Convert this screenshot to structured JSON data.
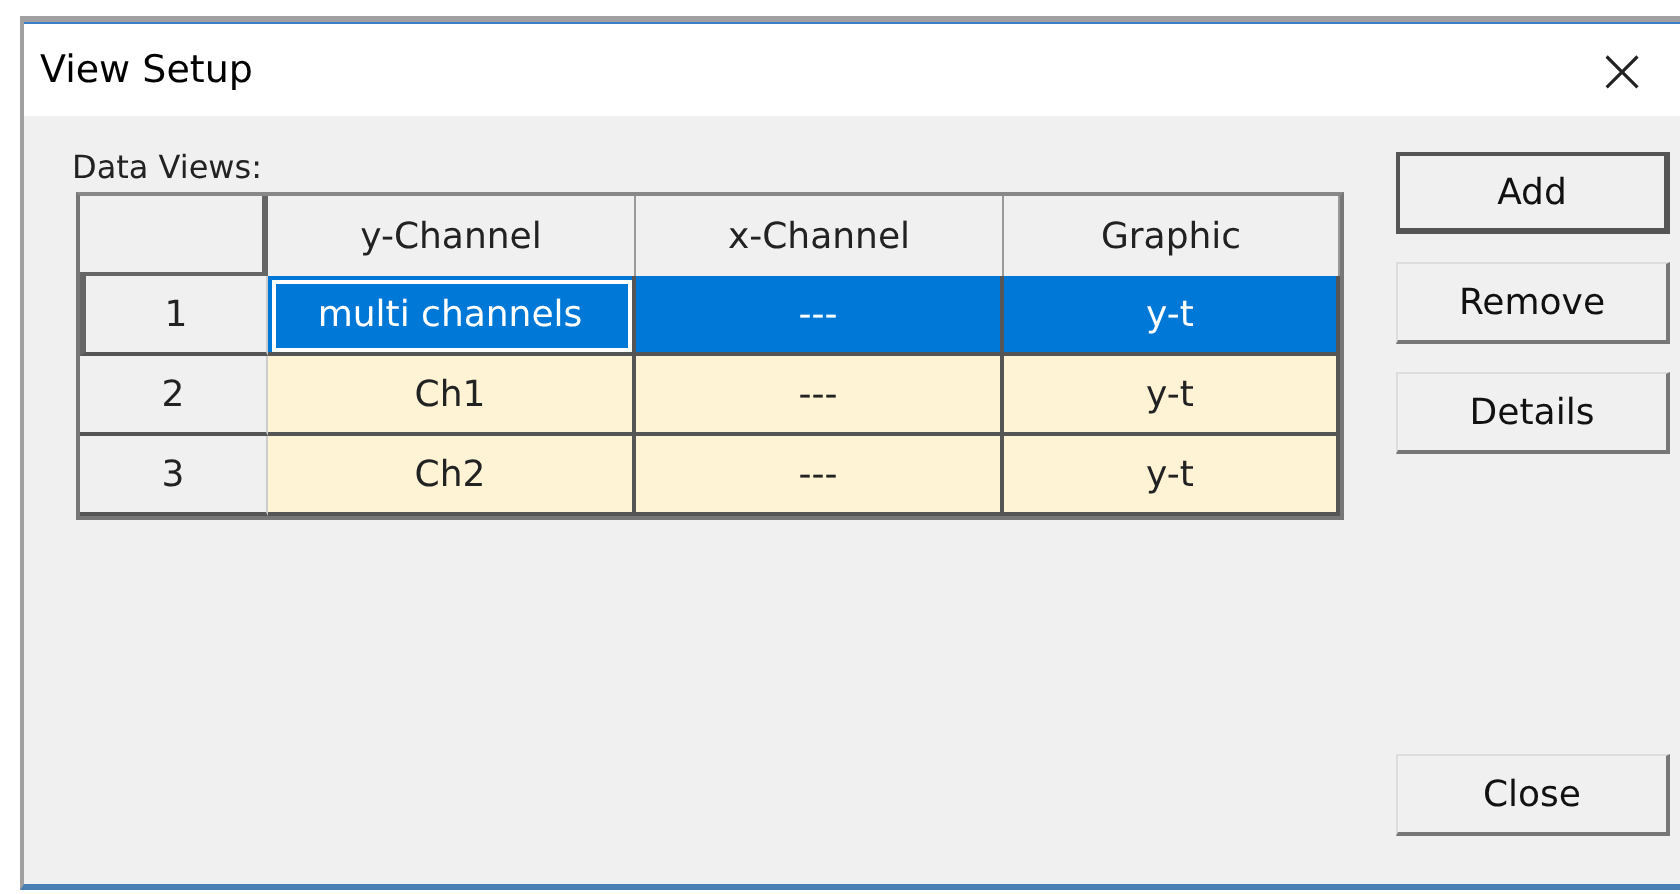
{
  "window": {
    "title": "View Setup",
    "close": "×"
  },
  "group_label": "Data Views:",
  "table": {
    "columns": [
      "y-Channel",
      "x-Channel",
      "Graphic"
    ],
    "rows": [
      {
        "number": "1",
        "cells": [
          "multi channels",
          "---",
          "y-t"
        ],
        "selected": true
      },
      {
        "number": "2",
        "cells": [
          "Ch1",
          "---",
          "y-t"
        ],
        "selected": false
      },
      {
        "number": "3",
        "cells": [
          "Ch2",
          "---",
          "y-t"
        ],
        "selected": false
      }
    ]
  },
  "buttons": [
    {
      "label": "Add",
      "default": true
    },
    {
      "label": "Remove",
      "default": false
    },
    {
      "label": "Details",
      "default": false
    }
  ],
  "close_button": "Close"
}
